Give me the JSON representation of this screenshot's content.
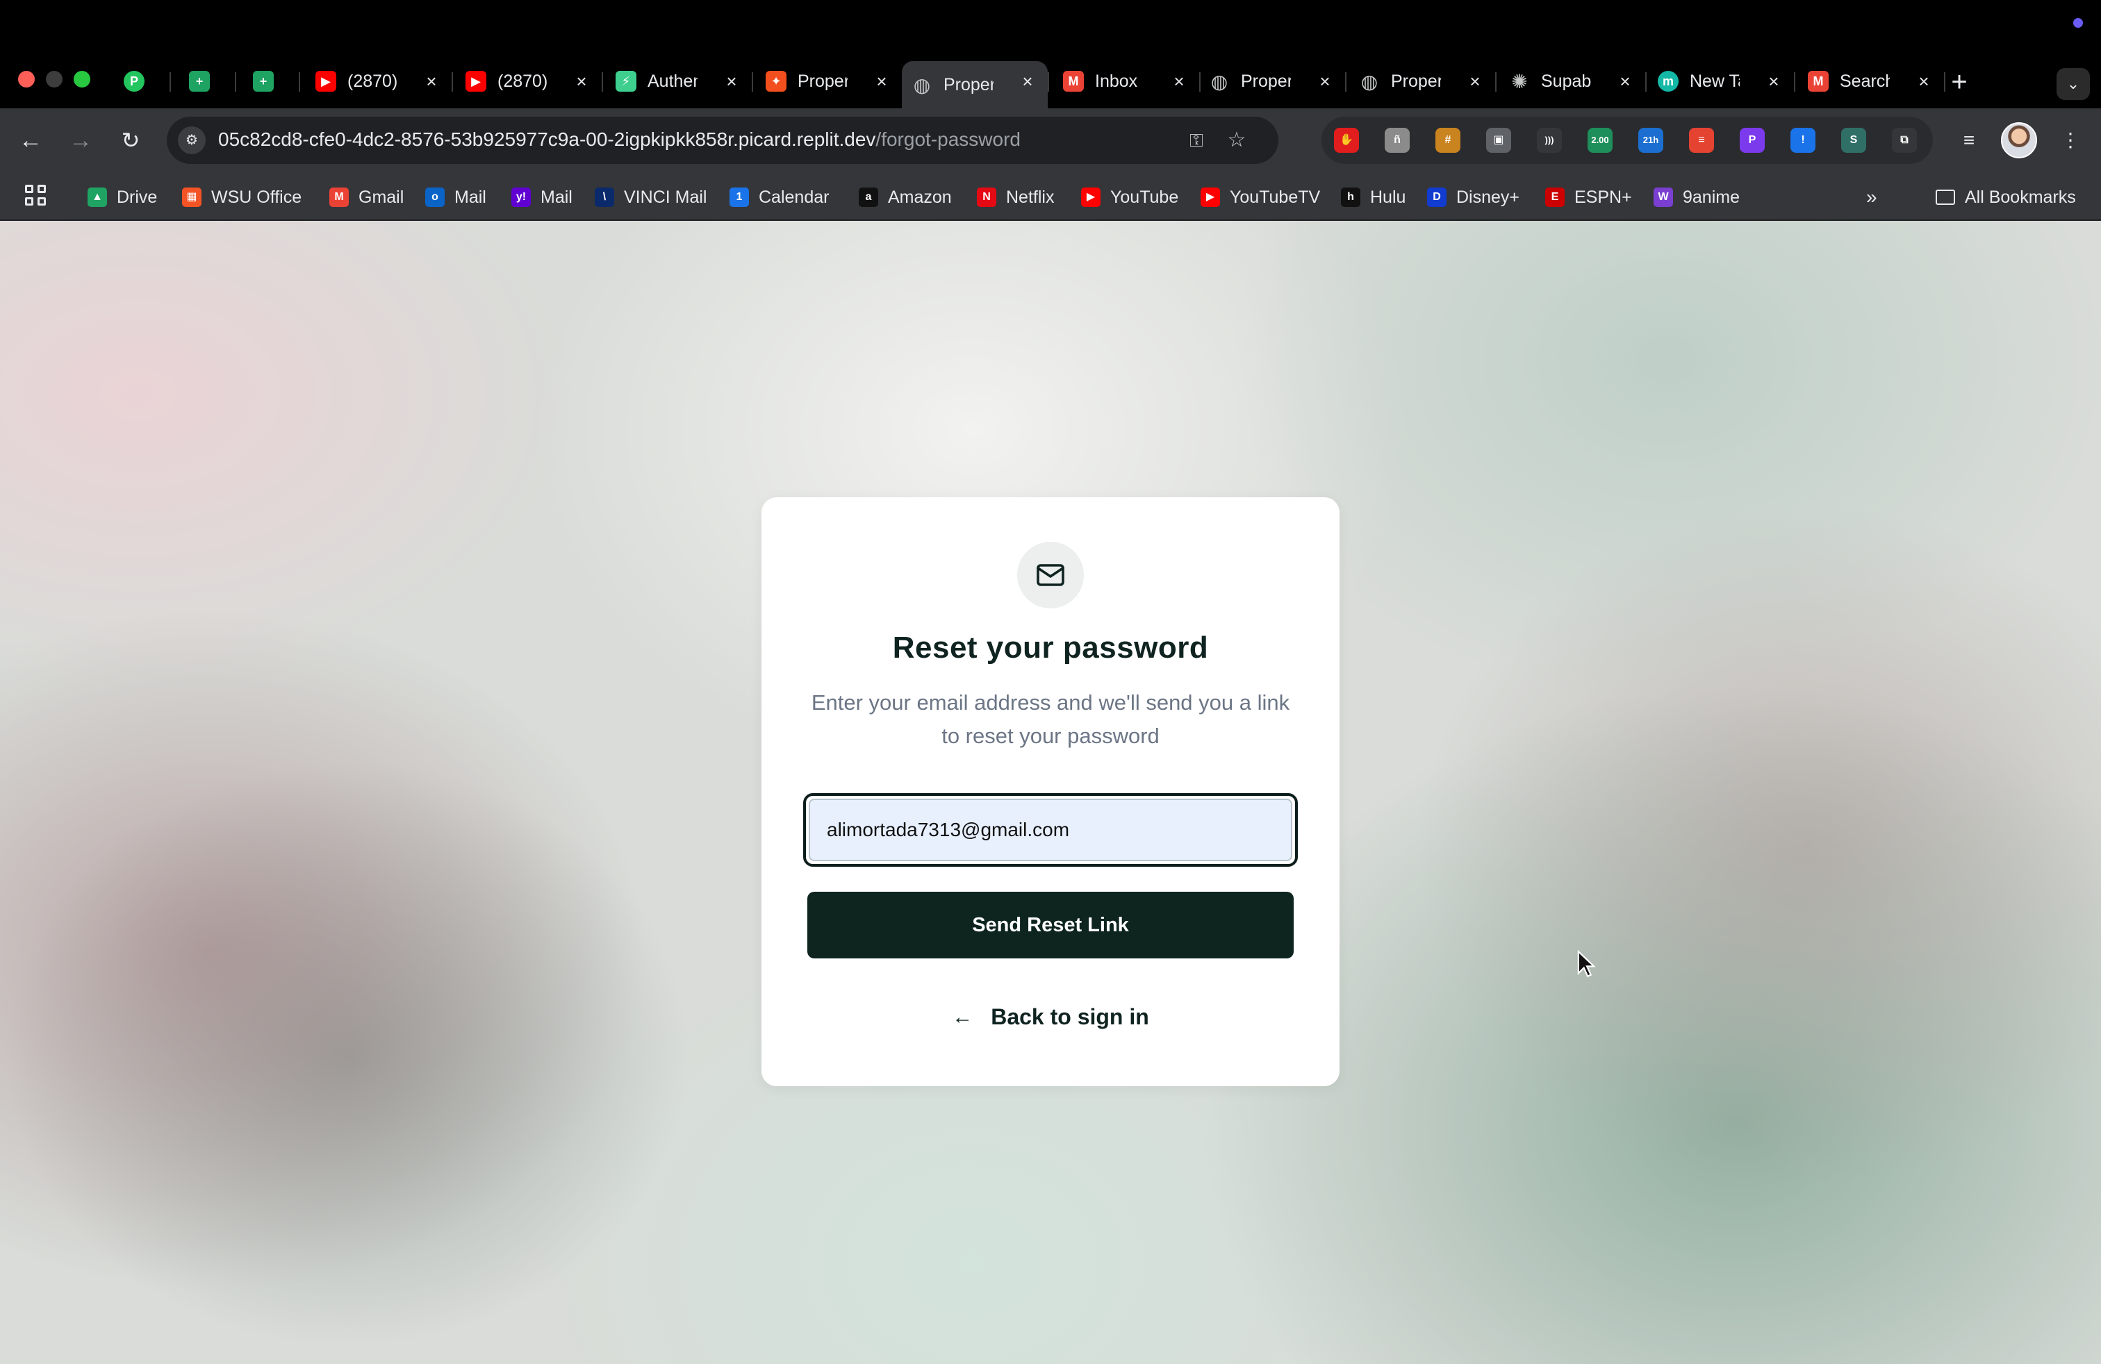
{
  "colors": {
    "accent": "#0d241f",
    "card_bg": "#ffffff",
    "input_autofill": "#e8f0fe"
  },
  "tabs": [
    {
      "title": "",
      "icon": "producthunt-icon",
      "color": "#22c55e",
      "glyph": "P"
    },
    {
      "title": "",
      "icon": "sheets-icon",
      "color": "#1ea362",
      "glyph": "+"
    },
    {
      "title": "",
      "icon": "sheets-icon",
      "color": "#1ea362",
      "glyph": "+"
    },
    {
      "title": "(2870)",
      "icon": "youtube-icon",
      "color": "#ff0000",
      "glyph": "▶"
    },
    {
      "title": "(2870)",
      "icon": "youtube-icon",
      "color": "#ff0000",
      "glyph": "▶"
    },
    {
      "title": "Authentication",
      "icon": "supabase-icon",
      "color": "#3ecf8e",
      "glyph": "⚡"
    },
    {
      "title": "Property",
      "icon": "figma-icon",
      "color": "#f24e1e",
      "glyph": "✦"
    },
    {
      "title": "Property",
      "icon": "globe-icon",
      "color": "#8a8f98",
      "glyph": "◍"
    },
    {
      "title": "Inbox",
      "icon": "gmail-icon",
      "color": "#ea4335",
      "glyph": "M"
    },
    {
      "title": "Property",
      "icon": "globe-icon",
      "color": "#8a8f98",
      "glyph": "◍"
    },
    {
      "title": "Property",
      "icon": "globe-icon",
      "color": "#8a8f98",
      "glyph": "◍"
    },
    {
      "title": "Supabase",
      "icon": "openai-icon",
      "color": "#ffffff",
      "glyph": "✺"
    },
    {
      "title": "New Tab",
      "icon": "m-icon",
      "color": "#14b8a6",
      "glyph": "m"
    },
    {
      "title": "Search",
      "icon": "gmail-icon",
      "color": "#ea4335",
      "glyph": "M"
    }
  ],
  "address_bar": {
    "host": "05c82cd8-cfe0-4dc2-8576-53b925977c9a-00-2igpkipkk858r.picard.replit.dev",
    "path": "/forgot-password"
  },
  "extensions": [
    {
      "name": "adblock-icon",
      "color": "#e11d1d",
      "glyph": "✋"
    },
    {
      "name": "extension-gray-icon",
      "color": "#8b8b8b",
      "glyph": "ñ"
    },
    {
      "name": "extension-orange-icon",
      "color": "#c9831f",
      "glyph": "#"
    },
    {
      "name": "screenshot-icon",
      "color": "#5f6368",
      "glyph": "▣"
    },
    {
      "name": "audio-icon",
      "color": "#35363a",
      "glyph": ")))"
    },
    {
      "name": "speed-icon",
      "color": "#1e8e5a",
      "glyph": "2.00"
    },
    {
      "name": "timer-icon",
      "color": "#1c6fd0",
      "glyph": "21h"
    },
    {
      "name": "todoist-icon",
      "color": "#e44332",
      "glyph": "≡"
    },
    {
      "name": "twitch-icon",
      "color": "#7c3aed",
      "glyph": "P"
    },
    {
      "name": "info-icon",
      "color": "#1a73e8",
      "glyph": "!"
    },
    {
      "name": "s-icon",
      "color": "#2f6f66",
      "glyph": "S"
    },
    {
      "name": "puzzle-icon",
      "color": "#35363a",
      "glyph": "⧉"
    }
  ],
  "bookmarks": [
    {
      "label": "Drive",
      "icon": "drive-icon",
      "color": "#1fa463",
      "glyph": "▲"
    },
    {
      "label": "WSU Office",
      "icon": "microsoft-icon",
      "color": "#f35325",
      "glyph": "▦"
    },
    {
      "label": "Gmail",
      "icon": "gmail-icon",
      "color": "#ea4335",
      "glyph": "M"
    },
    {
      "label": "Mail",
      "icon": "outlook-icon",
      "color": "#0a64c8",
      "glyph": "o"
    },
    {
      "label": "Mail",
      "icon": "yahoo-icon",
      "color": "#6001d2",
      "glyph": "y!"
    },
    {
      "label": "VINCI Mail",
      "icon": "vinci-icon",
      "color": "#0b2a6b",
      "glyph": "\\"
    },
    {
      "label": "Calendar",
      "icon": "calendar-icon",
      "color": "#1a73e8",
      "glyph": "1"
    },
    {
      "label": "Amazon",
      "icon": "amazon-icon",
      "color": "#111111",
      "glyph": "a"
    },
    {
      "label": "Netflix",
      "icon": "netflix-icon",
      "color": "#e50914",
      "glyph": "N"
    },
    {
      "label": "YouTube",
      "icon": "youtube-icon",
      "color": "#ff0000",
      "glyph": "▶"
    },
    {
      "label": "YouTubeTV",
      "icon": "youtubetv-icon",
      "color": "#ff0000",
      "glyph": "▶"
    },
    {
      "label": "Hulu",
      "icon": "hulu-icon",
      "color": "#111111",
      "glyph": "h"
    },
    {
      "label": "Disney+",
      "icon": "disney-icon",
      "color": "#113ccf",
      "glyph": "D"
    },
    {
      "label": "ESPN+",
      "icon": "espn-icon",
      "color": "#cc0000",
      "glyph": "E"
    },
    {
      "label": "9anime",
      "icon": "9anime-icon",
      "color": "#7a3fd1",
      "glyph": "W"
    }
  ],
  "all_bookmarks_label": "All Bookmarks",
  "card": {
    "title": "Reset your password",
    "subtitle": "Enter your email address and we'll send you a link to reset your password",
    "email_value": "alimortada7313@gmail.com",
    "submit_label": "Send Reset Link",
    "back_label": "Back to sign in"
  }
}
